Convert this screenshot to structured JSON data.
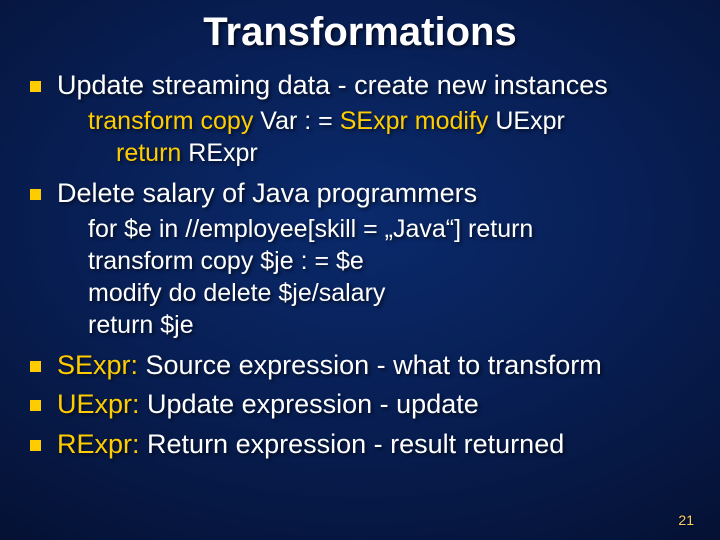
{
  "title": "Transformations",
  "items": [
    {
      "text": "Update streaming data - create new instances",
      "sub": [
        {
          "segments": [
            {
              "t": "transform copy ",
              "c": "kw"
            },
            {
              "t": "Var",
              "c": "var"
            },
            {
              "t": " : = ",
              "c": "var"
            },
            {
              "t": "SExpr modify ",
              "c": "kw"
            },
            {
              "t": "UExpr",
              "c": "var"
            }
          ]
        },
        {
          "indent": true,
          "segments": [
            {
              "t": "return ",
              "c": "kw"
            },
            {
              "t": "RExpr",
              "c": "var"
            }
          ]
        }
      ]
    },
    {
      "text": "Delete salary of Java programmers",
      "sub": [
        {
          "segments": [
            {
              "t": "for $e in //employee[skill = „Java“] return",
              "c": "var"
            }
          ]
        },
        {
          "segments": [
            {
              "t": "transform copy $je : = $e",
              "c": "var"
            }
          ]
        },
        {
          "segments": [
            {
              "t": "modify   do delete $je/salary",
              "c": "var"
            }
          ]
        },
        {
          "segments": [
            {
              "t": "return $je",
              "c": "var"
            }
          ]
        }
      ]
    },
    {
      "segments": [
        {
          "t": "SExpr:",
          "c": "kw"
        },
        {
          "t": " Source expression - what to transform",
          "c": "var"
        }
      ]
    },
    {
      "segments": [
        {
          "t": "UExpr:",
          "c": "kw"
        },
        {
          "t": " Update expression - update",
          "c": "var"
        }
      ]
    },
    {
      "segments": [
        {
          "t": "RExpr: ",
          "c": "kw"
        },
        {
          "t": " Return expression - result returned",
          "c": "var"
        }
      ]
    }
  ],
  "pageNumber": "21"
}
